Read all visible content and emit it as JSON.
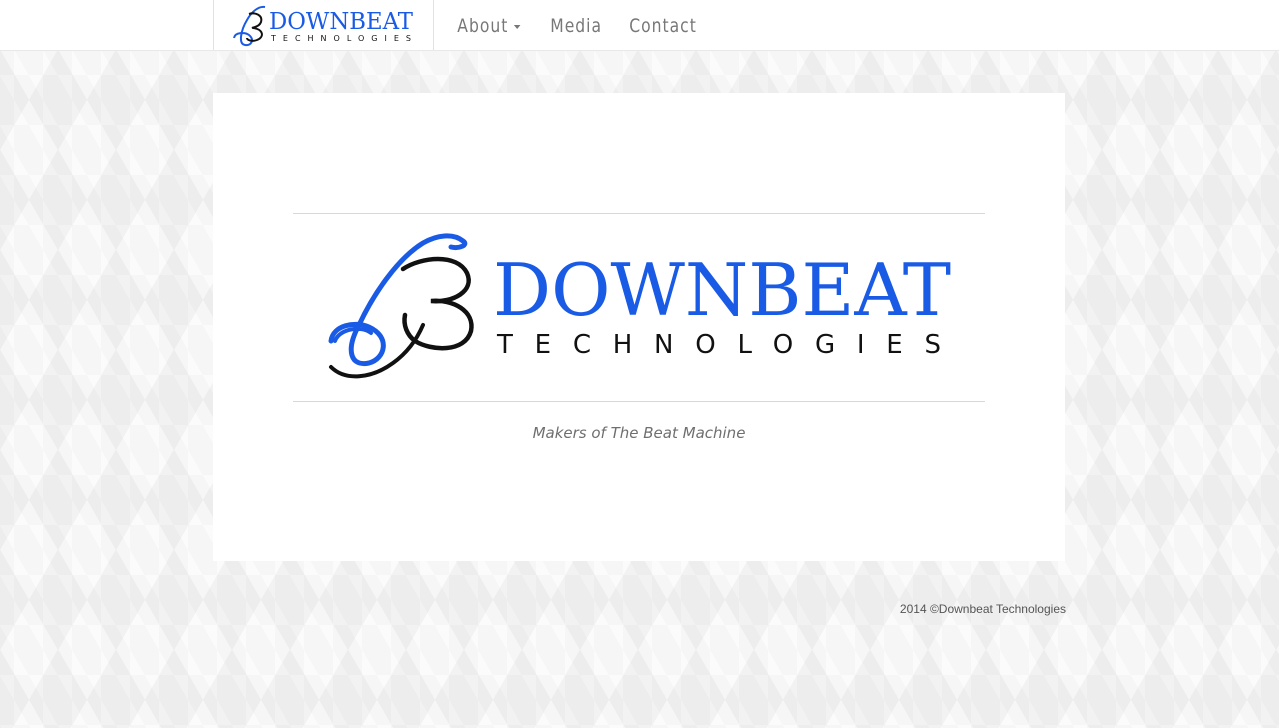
{
  "brand": {
    "name": "DOWNBEAT",
    "subtitle": "TECHNOLOGIES",
    "primary_color": "#1a5be6",
    "dark_color": "#111111"
  },
  "nav": {
    "items": [
      {
        "label": "About",
        "has_dropdown": true
      },
      {
        "label": "Media",
        "has_dropdown": false
      },
      {
        "label": "Contact",
        "has_dropdown": false
      }
    ]
  },
  "hero": {
    "title": "DOWNBEAT",
    "subtitle": "TECHNOLOGIES",
    "tagline": "Makers of The Beat Machine"
  },
  "footer": {
    "copyright": "2014 ©Downbeat Technologies"
  }
}
